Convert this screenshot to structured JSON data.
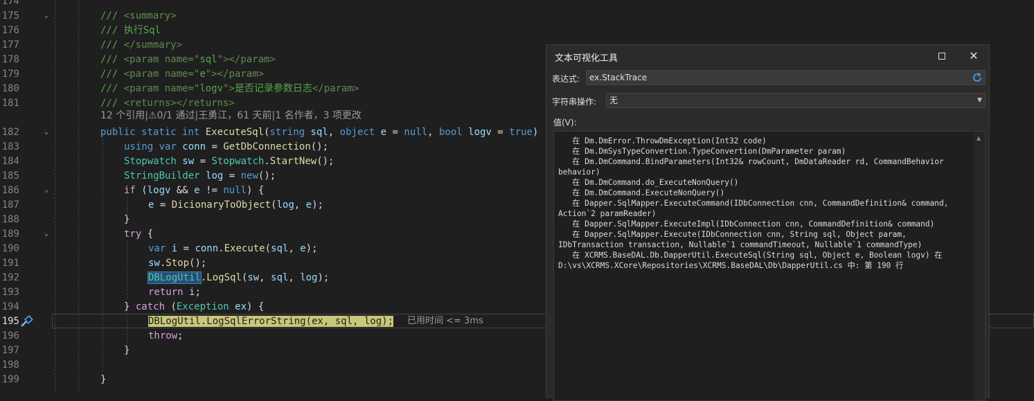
{
  "editor": {
    "lines": [
      {
        "num": "174"
      },
      {
        "num": "175",
        "tokens": [
          {
            "t": "/// ",
            "c": "c-com"
          },
          {
            "t": "<summary>",
            "c": "c-xml"
          }
        ]
      },
      {
        "num": "176",
        "tokens": [
          {
            "t": "/// 执行Sql",
            "c": "c-com"
          }
        ]
      },
      {
        "num": "177",
        "tokens": [
          {
            "t": "/// ",
            "c": "c-com"
          },
          {
            "t": "</summary>",
            "c": "c-xml"
          }
        ]
      },
      {
        "num": "178",
        "tokens": [
          {
            "t": "/// ",
            "c": "c-com"
          },
          {
            "t": "<param ",
            "c": "c-xml"
          },
          {
            "t": "name=",
            "c": "c-xml"
          },
          {
            "t": "\"",
            "c": "c-xml"
          },
          {
            "t": "sql",
            "c": "c-com"
          },
          {
            "t": "\"></param>",
            "c": "c-xml"
          }
        ]
      },
      {
        "num": "179",
        "tokens": [
          {
            "t": "/// ",
            "c": "c-com"
          },
          {
            "t": "<param ",
            "c": "c-xml"
          },
          {
            "t": "name=",
            "c": "c-xml"
          },
          {
            "t": "\"",
            "c": "c-xml"
          },
          {
            "t": "e",
            "c": "c-com"
          },
          {
            "t": "\"></param>",
            "c": "c-xml"
          }
        ]
      },
      {
        "num": "180",
        "tokens": [
          {
            "t": "/// ",
            "c": "c-com"
          },
          {
            "t": "<param ",
            "c": "c-xml"
          },
          {
            "t": "name=",
            "c": "c-xml"
          },
          {
            "t": "\"",
            "c": "c-xml"
          },
          {
            "t": "logv",
            "c": "c-com"
          },
          {
            "t": "\">",
            "c": "c-xml"
          },
          {
            "t": "是否记录参数日志",
            "c": "c-com"
          },
          {
            "t": "</param>",
            "c": "c-xml"
          }
        ]
      },
      {
        "num": "181",
        "tokens": [
          {
            "t": "/// ",
            "c": "c-com"
          },
          {
            "t": "<returns></returns>",
            "c": "c-xml"
          }
        ]
      },
      {
        "num": "182",
        "tokens": [
          {
            "t": "public ",
            "c": "c-kw"
          },
          {
            "t": "static ",
            "c": "c-kw"
          },
          {
            "t": "int ",
            "c": "c-kw"
          },
          {
            "t": "ExecuteSql",
            "c": "c-met"
          },
          {
            "t": "("
          },
          {
            "t": "string ",
            "c": "c-kw"
          },
          {
            "t": "sql",
            "c": "c-var"
          },
          {
            "t": ", "
          },
          {
            "t": "object ",
            "c": "c-kw"
          },
          {
            "t": "e",
            "c": "c-var"
          },
          {
            "t": " = "
          },
          {
            "t": "null",
            "c": "c-kw"
          },
          {
            "t": ", "
          },
          {
            "t": "bool ",
            "c": "c-kw"
          },
          {
            "t": "logv",
            "c": "c-var"
          },
          {
            "t": " = "
          },
          {
            "t": "true",
            "c": "c-kw"
          },
          {
            "t": ")"
          }
        ]
      },
      {
        "num": "183",
        "tokens": [
          {
            "t": "using ",
            "c": "c-kw"
          },
          {
            "t": "var ",
            "c": "c-kw"
          },
          {
            "t": "conn",
            "c": "c-var"
          },
          {
            "t": " = "
          },
          {
            "t": "GetDbConnection",
            "c": "c-met"
          },
          {
            "t": "();"
          }
        ]
      },
      {
        "num": "184",
        "tokens": [
          {
            "t": "Stopwatch ",
            "c": "c-typ"
          },
          {
            "t": "sw",
            "c": "c-var"
          },
          {
            "t": " = "
          },
          {
            "t": "Stopwatch",
            "c": "c-typ"
          },
          {
            "t": "."
          },
          {
            "t": "StartNew",
            "c": "c-met"
          },
          {
            "t": "();"
          }
        ]
      },
      {
        "num": "185",
        "tokens": [
          {
            "t": "StringBuilder ",
            "c": "c-typ"
          },
          {
            "t": "log",
            "c": "c-var"
          },
          {
            "t": " = "
          },
          {
            "t": "new",
            "c": "c-kw"
          },
          {
            "t": "();"
          }
        ]
      },
      {
        "num": "186",
        "tokens": [
          {
            "t": "if ",
            "c": "c-ctl"
          },
          {
            "t": "("
          },
          {
            "t": "logv",
            "c": "c-var"
          },
          {
            "t": " && "
          },
          {
            "t": "e",
            "c": "c-var"
          },
          {
            "t": " != "
          },
          {
            "t": "null",
            "c": "c-kw"
          },
          {
            "t": ") {"
          }
        ]
      },
      {
        "num": "187",
        "tokens": [
          {
            "t": "e",
            "c": "c-var"
          },
          {
            "t": " = "
          },
          {
            "t": "DicionaryToObject",
            "c": "c-met"
          },
          {
            "t": "("
          },
          {
            "t": "log",
            "c": "c-var"
          },
          {
            "t": ", "
          },
          {
            "t": "e",
            "c": "c-var"
          },
          {
            "t": ");"
          }
        ]
      },
      {
        "num": "188",
        "tokens": [
          {
            "t": "}"
          }
        ]
      },
      {
        "num": "189",
        "tokens": [
          {
            "t": "try ",
            "c": "c-ctl"
          },
          {
            "t": "{"
          }
        ]
      },
      {
        "num": "190",
        "tokens": [
          {
            "t": "var ",
            "c": "c-kw"
          },
          {
            "t": "i",
            "c": "c-var"
          },
          {
            "t": " = "
          },
          {
            "t": "conn",
            "c": "c-var"
          },
          {
            "t": "."
          },
          {
            "t": "Execute",
            "c": "c-met"
          },
          {
            "t": "("
          },
          {
            "t": "sql",
            "c": "c-var"
          },
          {
            "t": ", "
          },
          {
            "t": "e",
            "c": "c-var"
          },
          {
            "t": ");"
          }
        ]
      },
      {
        "num": "191",
        "tokens": [
          {
            "t": "sw",
            "c": "c-var"
          },
          {
            "t": "."
          },
          {
            "t": "Stop",
            "c": "c-met"
          },
          {
            "t": "();"
          }
        ]
      },
      {
        "num": "192",
        "tokens": [
          {
            "t": "DBLogUtil",
            "c": "c-typ hl-ref"
          },
          {
            "t": "."
          },
          {
            "t": "LogSql",
            "c": "c-met"
          },
          {
            "t": "("
          },
          {
            "t": "sw",
            "c": "c-var"
          },
          {
            "t": ", "
          },
          {
            "t": "sql",
            "c": "c-var"
          },
          {
            "t": ", "
          },
          {
            "t": "log",
            "c": "c-var"
          },
          {
            "t": ");"
          }
        ]
      },
      {
        "num": "193",
        "tokens": [
          {
            "t": "return ",
            "c": "c-ctl"
          },
          {
            "t": "i",
            "c": "c-var"
          },
          {
            "t": ";"
          }
        ]
      },
      {
        "num": "194",
        "tokens": [
          {
            "t": "} "
          },
          {
            "t": "catch ",
            "c": "c-ctl"
          },
          {
            "t": "("
          },
          {
            "t": "Exception ",
            "c": "c-typ"
          },
          {
            "t": "ex",
            "c": "c-var"
          },
          {
            "t": ") {"
          }
        ]
      },
      {
        "num": "195",
        "tokens": [
          {
            "t": "DBLogUtil.LogSqlErrorString(ex, sql, log);",
            "c": "hl-stmt"
          }
        ]
      },
      {
        "num": "196",
        "tokens": [
          {
            "t": "throw",
            "c": "c-ctl"
          },
          {
            "t": ";"
          }
        ]
      },
      {
        "num": "197",
        "tokens": [
          {
            "t": "}"
          }
        ]
      },
      {
        "num": "198"
      },
      {
        "num": "199",
        "tokens": [
          {
            "t": "}"
          }
        ]
      }
    ],
    "codelens": "12 个引用|⚠0/1 通过|王勇江，61 天前|1 名作者，3 项更改",
    "perf_tip": "已用时间 <= 3ms"
  },
  "dialog": {
    "title": "文本可视化工具",
    "maximize_icon": "maximize-icon",
    "close_icon": "close-icon",
    "close_glyph": "✕",
    "expr_label": "表达式:",
    "expr_value": "ex.StackTrace",
    "op_label": "字符串操作:",
    "op_value": "无",
    "value_label": "值(V):",
    "value_text": "   在 Dm.DmError.ThrowDmException(Int32 code)\n   在 Dm.DmSysTypeConvertion.TypeConvertion(DmParameter param)\n   在 Dm.DmCommand.BindParameters(Int32& rowCount, DmDataReader rd, CommandBehavior behavior)\n   在 Dm.DmCommand.do_ExecuteNonQuery()\n   在 Dm.DmCommand.ExecuteNonQuery()\n   在 Dapper.SqlMapper.ExecuteCommand(IDbConnection cnn, CommandDefinition& command, Action`2 paramReader)\n   在 Dapper.SqlMapper.ExecuteImpl(IDbConnection cnn, CommandDefinition& command)\n   在 Dapper.SqlMapper.Execute(IDbConnection cnn, String sql, Object param, IDbTransaction transaction, Nullable`1 commandTimeout, Nullable`1 commandType)\n   在 XCRMS.BaseDAL.Db.DapperUtil.ExecuteSql(String sql, Object e, Boolean logv) 在 D:\\vs\\XCRMS.XCore\\Repositories\\XCRMS.BaseDAL\\Db\\DapperUtil.cs 中: 第 190 行"
  }
}
